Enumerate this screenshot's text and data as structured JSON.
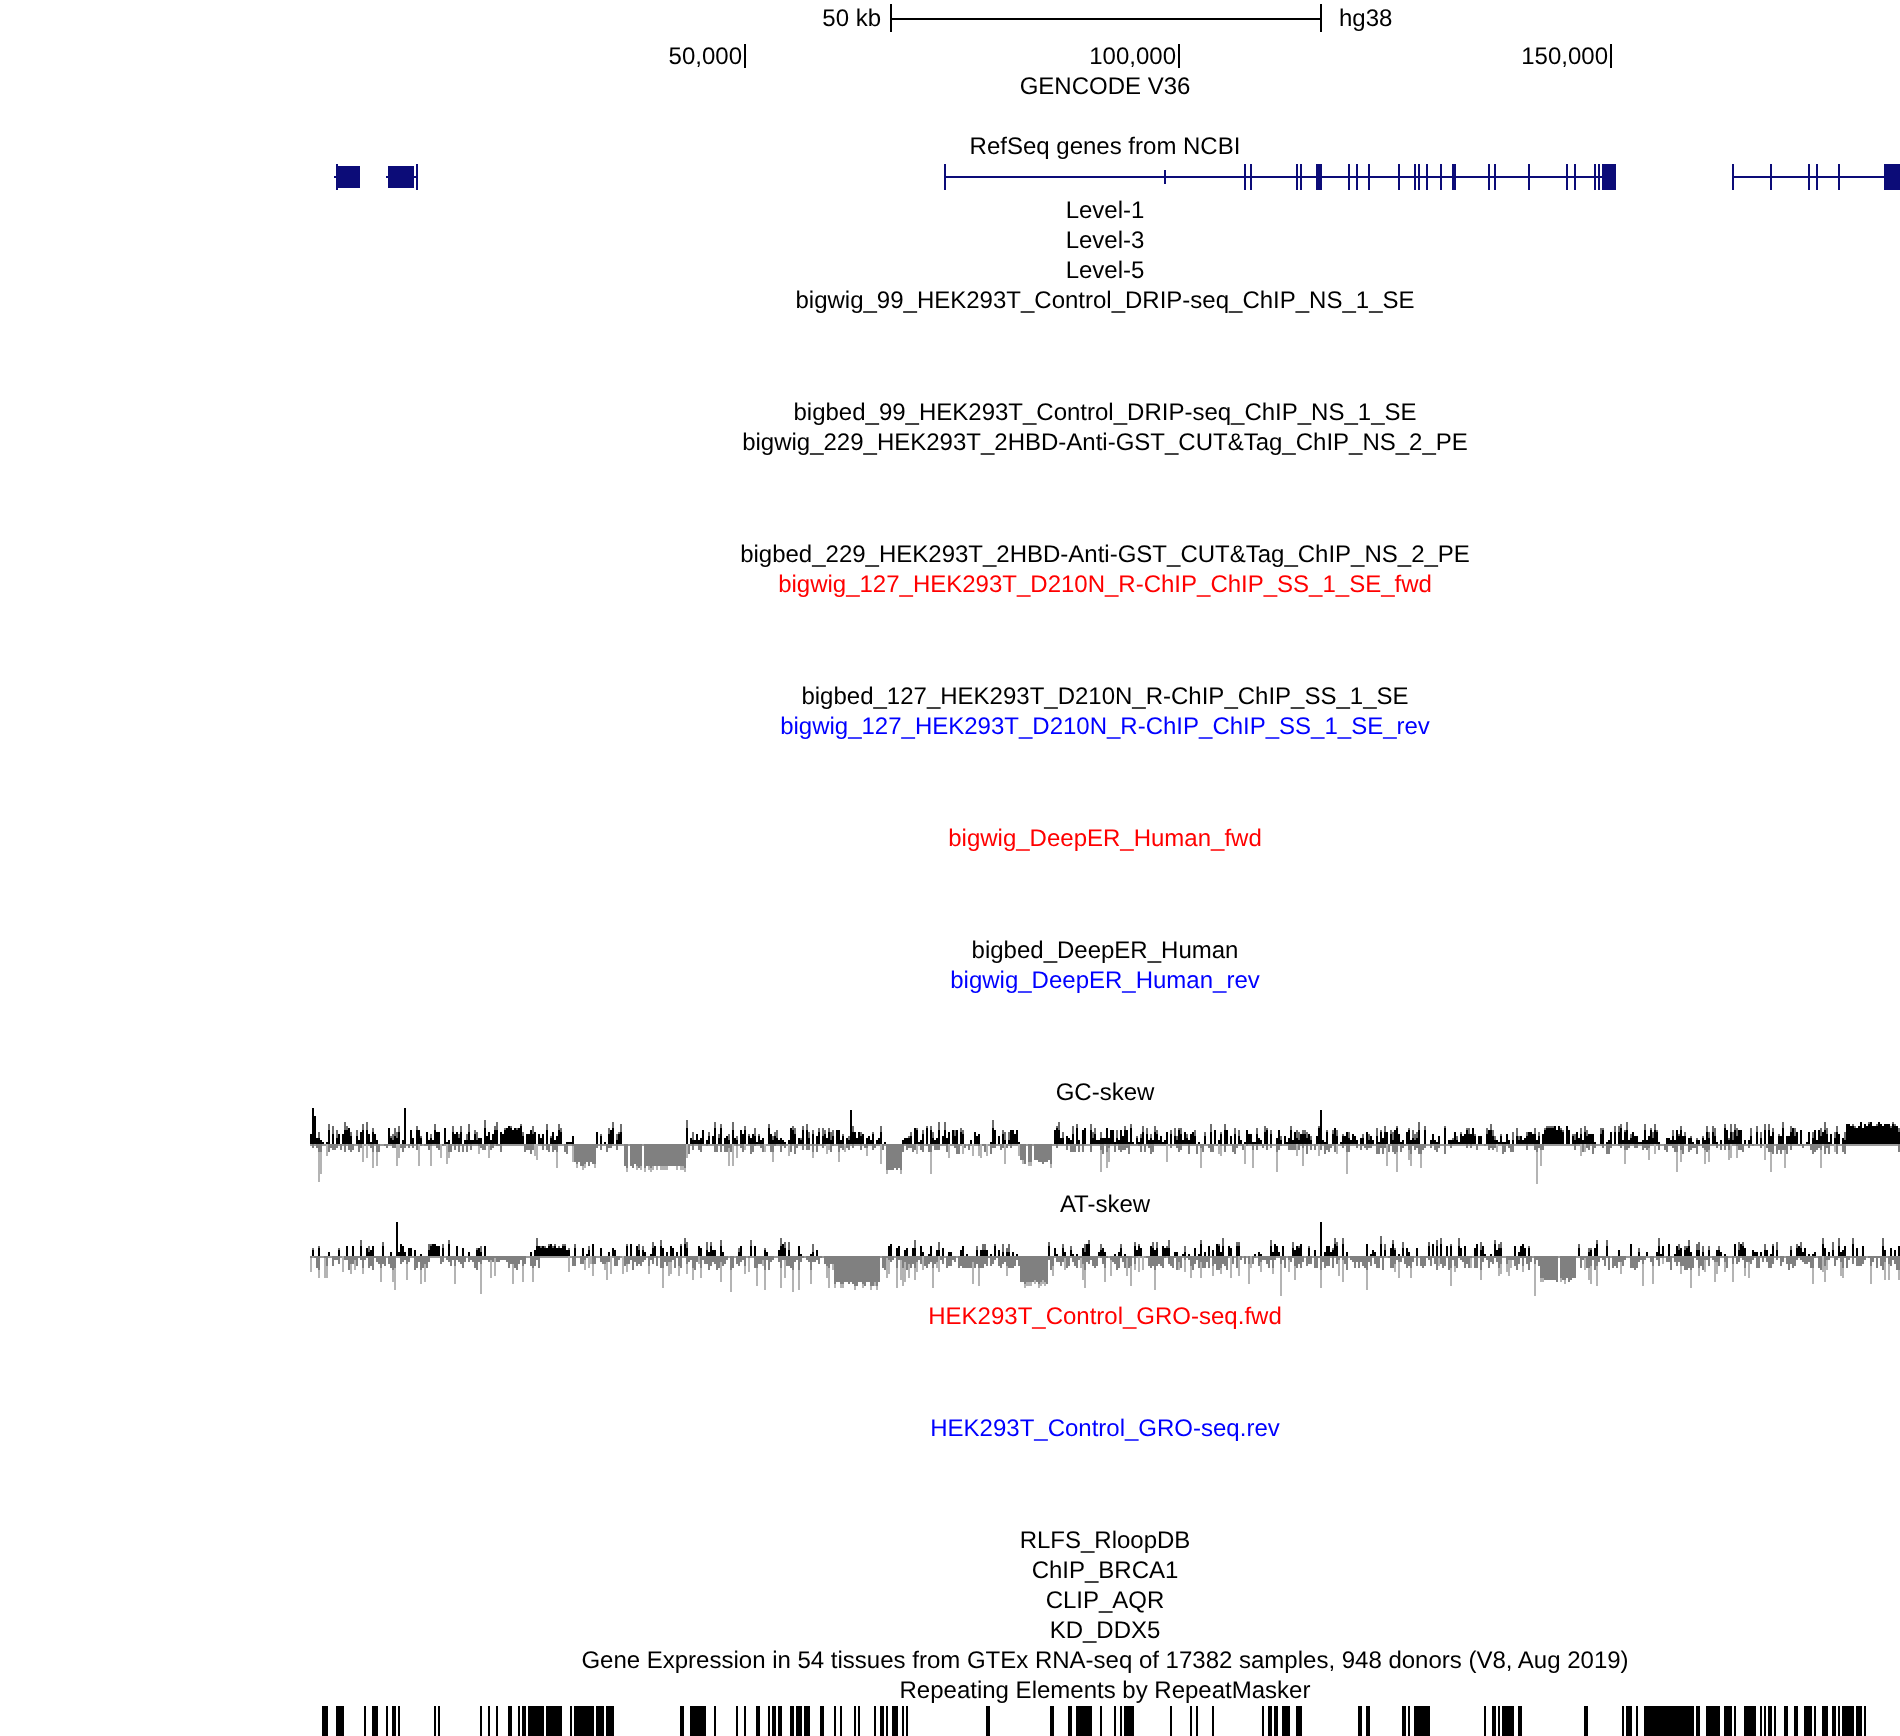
{
  "ruler": {
    "scale_label": "50 kb",
    "assembly": "hg38",
    "positions": [
      "50,000",
      "100,000",
      "150,000"
    ]
  },
  "tracks": [
    {
      "label": "GENCODE V36",
      "color": "#000000",
      "kind": "annotation"
    },
    {
      "label": "RefSeq genes from NCBI",
      "color": "#000000",
      "kind": "genes"
    },
    {
      "label": "Level-1",
      "color": "#000000",
      "kind": "feature"
    },
    {
      "label": "Level-3",
      "color": "#000000",
      "kind": "feature"
    },
    {
      "label": "Level-5",
      "color": "#000000",
      "kind": "feature"
    },
    {
      "label": "bigwig_99_HEK293T_Control_DRIP-seq_ChIP_NS_1_SE",
      "color": "#000000",
      "kind": "signal"
    },
    {
      "label": "bigbed_99_HEK293T_Control_DRIP-seq_ChIP_NS_1_SE",
      "color": "#000000",
      "kind": "feature"
    },
    {
      "label": "bigwig_229_HEK293T_2HBD-Anti-GST_CUT&Tag_ChIP_NS_2_PE",
      "color": "#000000",
      "kind": "signal"
    },
    {
      "label": "bigbed_229_HEK293T_2HBD-Anti-GST_CUT&Tag_ChIP_NS_2_PE",
      "color": "#000000",
      "kind": "feature"
    },
    {
      "label": "bigwig_127_HEK293T_D210N_R-ChIP_ChIP_SS_1_SE_fwd",
      "color": "#ff0000",
      "kind": "signal"
    },
    {
      "label": "bigbed_127_HEK293T_D210N_R-ChIP_ChIP_SS_1_SE",
      "color": "#000000",
      "kind": "feature"
    },
    {
      "label": "bigwig_127_HEK293T_D210N_R-ChIP_ChIP_SS_1_SE_rev",
      "color": "#0000ff",
      "kind": "signal"
    },
    {
      "label": "bigwig_DeepER_Human_fwd",
      "color": "#ff0000",
      "kind": "signal"
    },
    {
      "label": "bigbed_DeepER_Human",
      "color": "#000000",
      "kind": "feature"
    },
    {
      "label": "bigwig_DeepER_Human_rev",
      "color": "#0000ff",
      "kind": "signal"
    },
    {
      "label": "GC-skew",
      "color": "#000000",
      "kind": "skew"
    },
    {
      "label": "AT-skew",
      "color": "#000000",
      "kind": "skew"
    },
    {
      "label": "HEK293T_Control_GRO-seq.fwd",
      "color": "#ff0000",
      "kind": "signal"
    },
    {
      "label": "HEK293T_Control_GRO-seq.rev",
      "color": "#0000ff",
      "kind": "signal"
    },
    {
      "label": "RLFS_RloopDB",
      "color": "#000000",
      "kind": "feature"
    },
    {
      "label": "ChIP_BRCA1",
      "color": "#000000",
      "kind": "feature"
    },
    {
      "label": "CLIP_AQR",
      "color": "#000000",
      "kind": "feature"
    },
    {
      "label": "KD_DDX5",
      "color": "#000000",
      "kind": "feature"
    },
    {
      "label": "Gene Expression in 54 tissues from GTEx RNA-seq of 17382 samples, 948 donors (V8, Aug 2019)",
      "color": "#000000",
      "kind": "feature"
    },
    {
      "label": "Repeating Elements by RepeatMasker",
      "color": "#000000",
      "kind": "repeats"
    }
  ]
}
